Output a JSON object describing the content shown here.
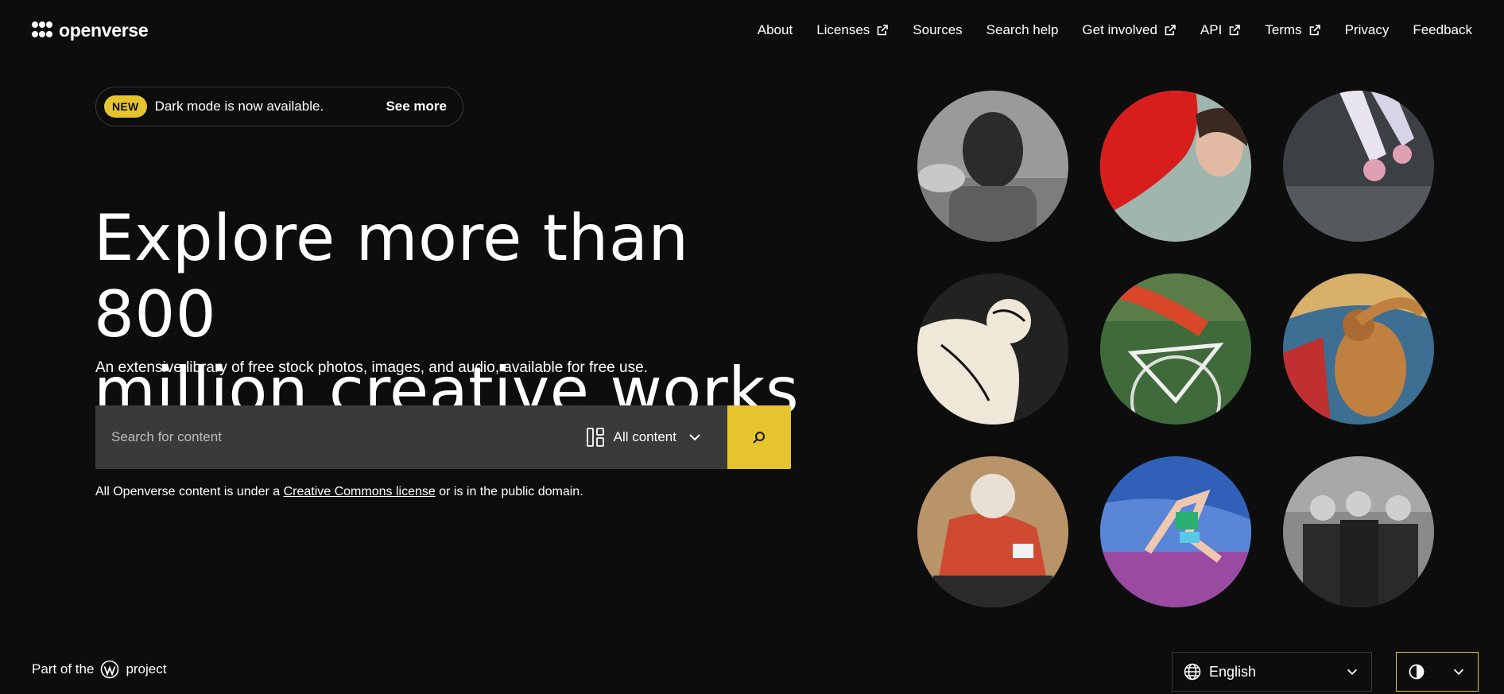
{
  "header": {
    "logo_text": "openverse",
    "nav": [
      {
        "label": "About",
        "external": false
      },
      {
        "label": "Licenses",
        "external": true
      },
      {
        "label": "Sources",
        "external": false
      },
      {
        "label": "Search help",
        "external": false
      },
      {
        "label": "Get involved",
        "external": true
      },
      {
        "label": "API",
        "external": true
      },
      {
        "label": "Terms",
        "external": true
      },
      {
        "label": "Privacy",
        "external": false
      },
      {
        "label": "Feedback",
        "external": false
      }
    ]
  },
  "banner": {
    "badge": "NEW",
    "text": "Dark mode is now available.",
    "link": "See more"
  },
  "hero": {
    "title_line1": "Explore more than 800",
    "title_line2": "million creative works",
    "subtitle": "An extensive library of free stock photos, images, and audio, available for free use."
  },
  "search": {
    "placeholder": "Search for content",
    "content_type": "All content"
  },
  "license_note": {
    "prefix": "All Openverse content is under a ",
    "link": "Creative Commons license",
    "suffix": " or is in the public domain."
  },
  "footer": {
    "part_of_prefix": "Part of the",
    "part_of_suffix": "project",
    "language": "English"
  },
  "colors": {
    "background": "#0d0d0d",
    "accent": "#e5c42e",
    "field": "#3a3a3a"
  },
  "icons": [
    "openverse-logo-icon",
    "external-link-icon",
    "content-grid-icon",
    "chevron-down-icon",
    "search-icon",
    "wordpress-icon",
    "globe-icon",
    "contrast-icon"
  ]
}
